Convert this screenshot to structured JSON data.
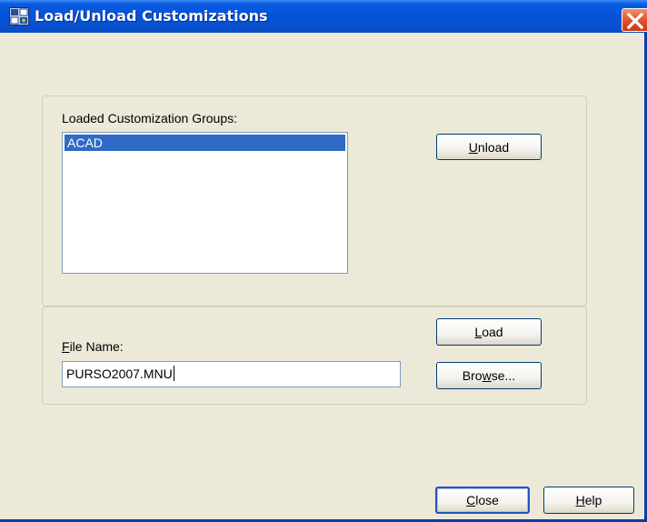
{
  "window": {
    "title": "Load/Unload Customizations",
    "titlebar_color": "#0553d8",
    "background": "#ece9d8"
  },
  "groups": {
    "label": "Loaded Customization Groups:",
    "items": [
      "ACAD"
    ],
    "selected_item": "ACAD"
  },
  "buttons": {
    "unload": {
      "underline": "U",
      "rest": "nload"
    },
    "load": {
      "underline": "L",
      "rest": "oad"
    },
    "browse": {
      "before": "Bro",
      "underline": "w",
      "after": "se..."
    },
    "close": {
      "underline": "C",
      "rest": "lose"
    },
    "help": {
      "underline": "H",
      "rest": "elp"
    }
  },
  "file": {
    "label_underline": "F",
    "label_rest": "ile Name:",
    "value": "PURSO2007.MNU"
  },
  "icons": {
    "app": "autocad-app-icon",
    "close": "close-icon"
  }
}
